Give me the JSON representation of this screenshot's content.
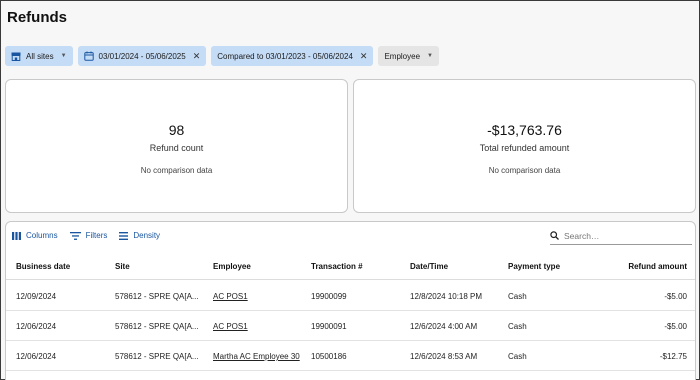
{
  "page": {
    "title": "Refunds"
  },
  "filters": {
    "sites": "All sites",
    "date_range": "03/01/2024 - 05/06/2025",
    "comparison": "Compared to 03/01/2023 - 05/06/2024",
    "employee": "Employee"
  },
  "cards": [
    {
      "value": "98",
      "label": "Refund count",
      "note": "No comparison data"
    },
    {
      "value": "-$13,763.76",
      "label": "Total refunded amount",
      "note": "No comparison data"
    }
  ],
  "toolbar": {
    "columns": "Columns",
    "filters": "Filters",
    "density": "Density"
  },
  "search": {
    "placeholder": "Search…"
  },
  "table": {
    "headers": [
      "Business date",
      "Site",
      "Employee",
      "Transaction #",
      "Date/Time",
      "Payment type",
      "Refund amount"
    ],
    "rows": [
      [
        "12/09/2024",
        "578612 - SPRE QA[A...",
        "AC POS1",
        "19900099",
        "12/8/2024 10:18 PM",
        "Cash",
        "-$5.00"
      ],
      [
        "12/06/2024",
        "578612 - SPRE QA[A...",
        "AC POS1",
        "19900091",
        "12/6/2024 4:00 AM",
        "Cash",
        "-$5.00"
      ],
      [
        "12/06/2024",
        "578612 - SPRE QA[A...",
        "Martha AC Employee 30",
        "10500186",
        "12/6/2024 8:53 AM",
        "Cash",
        "-$12.75"
      ]
    ]
  },
  "colors": {
    "accent": "#1a56a0",
    "chip_blue": "#c5dcf6",
    "chip_grey": "#e5e5e5"
  }
}
